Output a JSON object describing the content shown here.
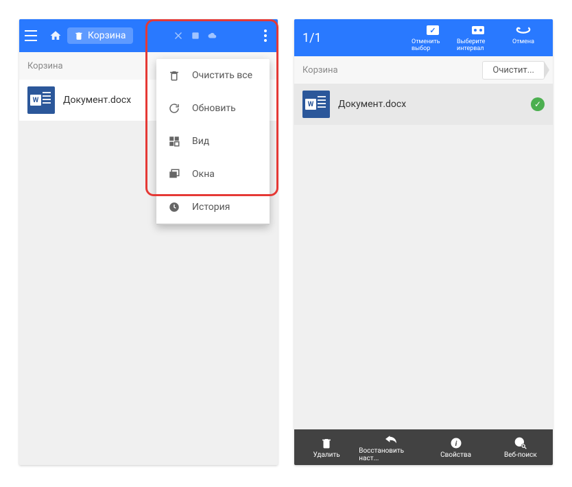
{
  "left": {
    "topbar": {
      "label": "Корзина"
    },
    "crumb": "Корзина",
    "file": "Документ.docx",
    "menu": [
      {
        "icon": "trash",
        "label": "Очистить все"
      },
      {
        "icon": "refresh",
        "label": "Обновить"
      },
      {
        "icon": "grid",
        "label": "Вид"
      },
      {
        "icon": "windows",
        "label": "Окна"
      },
      {
        "icon": "clock",
        "label": "История"
      }
    ]
  },
  "right": {
    "count": "1/1",
    "actions": {
      "deselect": "Отменить выбор",
      "range": "Выберите интервал",
      "cancel": "Отмена"
    },
    "crumb": "Корзина",
    "clear_btn": "Очистит...",
    "file": "Документ.docx",
    "bottom": {
      "delete": "Удалить",
      "restore": "Восстановить наст...",
      "props": "Свойства",
      "web": "Веб-поиск"
    }
  }
}
